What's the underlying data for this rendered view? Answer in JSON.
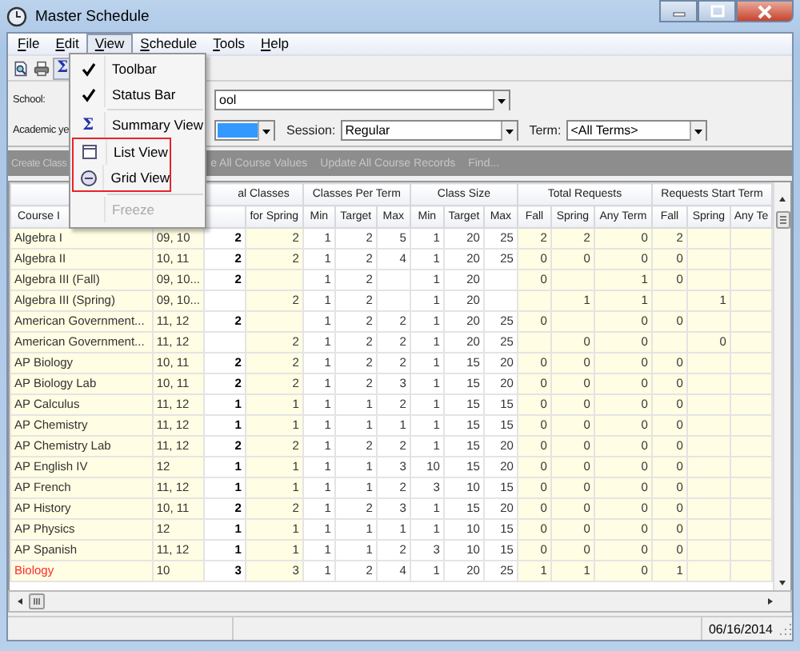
{
  "window": {
    "title": "Master Schedule"
  },
  "menu_bar": [
    {
      "label": "File",
      "selected": false
    },
    {
      "label": "Edit",
      "selected": false
    },
    {
      "label": "View",
      "selected": true
    },
    {
      "label": "Schedule",
      "selected": false
    },
    {
      "label": "Tools",
      "selected": false
    },
    {
      "label": "Help",
      "selected": false
    }
  ],
  "view_menu": {
    "items": [
      {
        "kind": "check",
        "label": "Toolbar",
        "checked": true
      },
      {
        "kind": "check",
        "label": "Status Bar",
        "checked": true
      },
      {
        "kind": "separator"
      },
      {
        "kind": "sigma",
        "label": "Summary View",
        "icon": "Σ"
      },
      {
        "kind": "group",
        "outlined": true,
        "items": [
          {
            "kind": "list",
            "label": "List View"
          },
          {
            "kind": "grid",
            "label": "Grid View"
          }
        ]
      },
      {
        "kind": "separator"
      },
      {
        "kind": "plain",
        "label": "Freeze",
        "disabled": true
      }
    ]
  },
  "toolbar": {
    "buttons": [
      {
        "kind": "preview"
      },
      {
        "kind": "print"
      },
      {
        "kind": "sigma",
        "icon": "Σ",
        "pressed": true
      }
    ]
  },
  "filters": {
    "school": {
      "label": "School:",
      "value": "ool"
    },
    "academic_year": {
      "label": "Academic ye",
      "selected": true
    },
    "session": {
      "label": "Session:",
      "value": "Regular"
    },
    "term": {
      "label": "Term:",
      "value": "<All Terms>"
    }
  },
  "actions": [
    {
      "label": "Create Class",
      "disabled": true
    },
    {
      "label": "e All Course Values",
      "disabled": true
    },
    {
      "label": "Update All Course Records",
      "disabled": true
    },
    {
      "label": "Find...",
      "disabled": true
    }
  ],
  "grid": {
    "column_groups": [
      {
        "columns": [
          "Course I",
          null
        ]
      },
      {
        "label": "al Classes",
        "columns": [
          null,
          "for Spring"
        ]
      },
      {
        "label": "Classes Per Term",
        "columns": [
          "Min",
          "Target",
          "Max"
        ]
      },
      {
        "label": "Class Size",
        "columns": [
          "Min",
          "Target",
          "Max"
        ]
      },
      {
        "label": "Total Requests",
        "columns": [
          "Fall",
          "Spring",
          "Any Term"
        ]
      },
      {
        "label": "Requests Start Term",
        "columns": [
          "Fall",
          "Spring",
          "Any Te"
        ]
      }
    ],
    "rows": [
      {
        "alert": false,
        "cells": [
          "Algebra I",
          "09, 10",
          "2",
          "2",
          "1",
          "2",
          "5",
          "1",
          "20",
          "25",
          "2",
          "2",
          "0",
          "2",
          null,
          null
        ]
      },
      {
        "alert": false,
        "cells": [
          "Algebra II",
          "10, 11",
          "2",
          "2",
          "1",
          "2",
          "4",
          "1",
          "20",
          "25",
          "0",
          "0",
          "0",
          "0",
          null,
          null
        ]
      },
      {
        "alert": false,
        "cells": [
          "Algebra III (Fall)",
          "09, 10...",
          "2",
          null,
          "1",
          "2",
          null,
          "1",
          "20",
          null,
          "0",
          null,
          "1",
          "0",
          null,
          null
        ]
      },
      {
        "alert": false,
        "cells": [
          "Algebra III (Spring)",
          "09, 10...",
          null,
          "2",
          "1",
          "2",
          null,
          "1",
          "20",
          null,
          null,
          "1",
          "1",
          null,
          "1",
          null
        ]
      },
      {
        "alert": false,
        "cells": [
          "American Government...",
          "11, 12",
          "2",
          null,
          "1",
          "2",
          "2",
          "1",
          "20",
          "25",
          "0",
          null,
          "0",
          "0",
          null,
          null
        ]
      },
      {
        "alert": false,
        "cells": [
          "American Government...",
          "11, 12",
          null,
          "2",
          "1",
          "2",
          "2",
          "1",
          "20",
          "25",
          null,
          "0",
          "0",
          null,
          "0",
          null
        ]
      },
      {
        "alert": false,
        "cells": [
          "AP Biology",
          "10, 11",
          "2",
          "2",
          "1",
          "2",
          "2",
          "1",
          "15",
          "20",
          "0",
          "0",
          "0",
          "0",
          null,
          null
        ]
      },
      {
        "alert": false,
        "cells": [
          "AP Biology Lab",
          "10, 11",
          "2",
          "2",
          "1",
          "2",
          "3",
          "1",
          "15",
          "20",
          "0",
          "0",
          "0",
          "0",
          null,
          null
        ]
      },
      {
        "alert": false,
        "cells": [
          "AP Calculus",
          "11, 12",
          "1",
          "1",
          "1",
          "1",
          "2",
          "1",
          "15",
          "15",
          "0",
          "0",
          "0",
          "0",
          null,
          null
        ]
      },
      {
        "alert": false,
        "cells": [
          "AP Chemistry",
          "11, 12",
          "1",
          "1",
          "1",
          "1",
          "1",
          "1",
          "15",
          "15",
          "0",
          "0",
          "0",
          "0",
          null,
          null
        ]
      },
      {
        "alert": false,
        "cells": [
          "AP Chemistry Lab",
          "11, 12",
          "2",
          "2",
          "1",
          "2",
          "2",
          "1",
          "15",
          "20",
          "0",
          "0",
          "0",
          "0",
          null,
          null
        ]
      },
      {
        "alert": false,
        "cells": [
          "AP English IV",
          "12",
          "1",
          "1",
          "1",
          "1",
          "3",
          "10",
          "15",
          "20",
          "0",
          "0",
          "0",
          "0",
          null,
          null
        ]
      },
      {
        "alert": false,
        "cells": [
          "AP French",
          "11, 12",
          "1",
          "1",
          "1",
          "1",
          "2",
          "3",
          "10",
          "15",
          "0",
          "0",
          "0",
          "0",
          null,
          null
        ]
      },
      {
        "alert": false,
        "cells": [
          "AP History",
          "10, 11",
          "2",
          "2",
          "1",
          "2",
          "3",
          "1",
          "15",
          "20",
          "0",
          "0",
          "0",
          "0",
          null,
          null
        ]
      },
      {
        "alert": false,
        "cells": [
          "AP Physics",
          "12",
          "1",
          "1",
          "1",
          "1",
          "1",
          "1",
          "10",
          "15",
          "0",
          "0",
          "0",
          "0",
          null,
          null
        ]
      },
      {
        "alert": false,
        "cells": [
          "AP Spanish",
          "11, 12",
          "1",
          "1",
          "1",
          "1",
          "2",
          "3",
          "10",
          "15",
          "0",
          "0",
          "0",
          "0",
          null,
          null
        ]
      },
      {
        "alert": true,
        "cells": [
          "Biology",
          "10",
          "3",
          "3",
          "1",
          "2",
          "4",
          "1",
          "20",
          "25",
          "1",
          "1",
          "0",
          "1",
          null,
          null
        ]
      }
    ]
  },
  "status_bar": {
    "date": "06/16/2014"
  }
}
